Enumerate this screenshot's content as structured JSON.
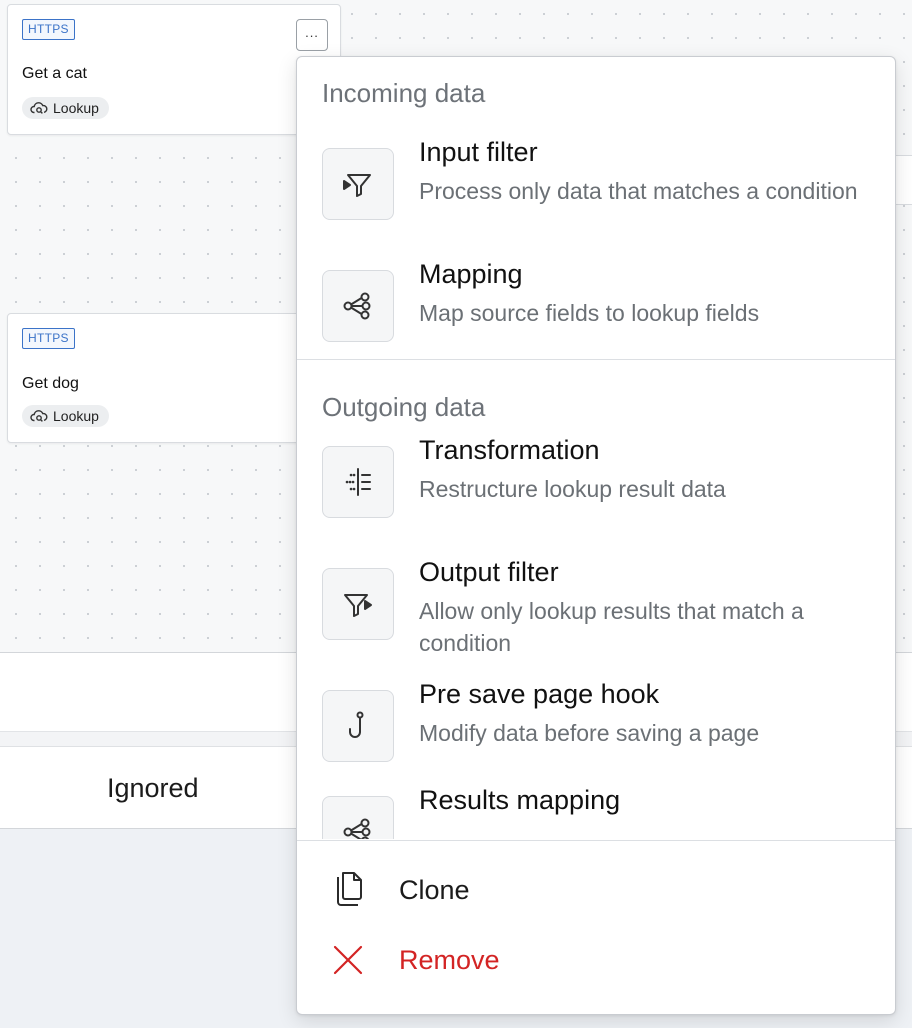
{
  "canvas": {
    "cards": [
      {
        "tag": "HTTPS",
        "title": "Get a cat",
        "type": "Lookup",
        "more": "..."
      },
      {
        "tag": "HTTPS",
        "title": "Get dog",
        "type": "Lookup"
      }
    ],
    "bottom": {
      "label": "Ignored"
    }
  },
  "menu": {
    "sections": [
      {
        "title": "Incoming data",
        "items": [
          {
            "title": "Input filter",
            "description": "Process only data that matches a condition",
            "icon": "input-filter-icon"
          },
          {
            "title": "Mapping",
            "description": "Map source fields to lookup fields",
            "icon": "mapping-icon"
          }
        ]
      },
      {
        "title": "Outgoing data",
        "items": [
          {
            "title": "Transformation",
            "description": "Restructure lookup result data",
            "icon": "transformation-icon"
          },
          {
            "title": "Output filter",
            "description": "Allow only lookup results that match a condition",
            "icon": "output-filter-icon"
          },
          {
            "title": "Pre save page hook",
            "description": "Modify data before saving a page",
            "icon": "hook-icon"
          },
          {
            "title": "Results mapping",
            "description": "",
            "icon": "results-mapping-icon"
          }
        ]
      }
    ],
    "footer": [
      {
        "label": "Clone",
        "icon": "clone-icon"
      },
      {
        "label": "Remove",
        "icon": "close-icon",
        "color": "#d32424"
      }
    ]
  }
}
